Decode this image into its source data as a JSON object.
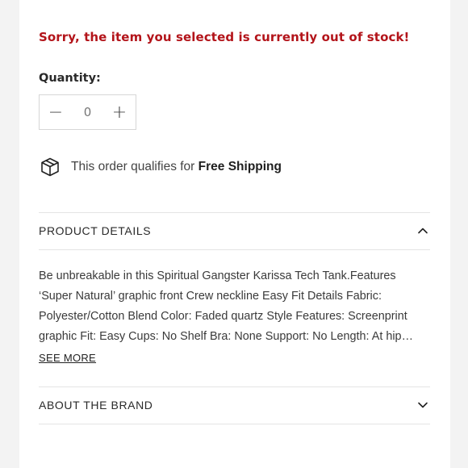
{
  "stock": {
    "message": "Sorry, the item you selected is currently out of stock!",
    "color": "#b3141a"
  },
  "quantity": {
    "label": "Quantity:",
    "value": "0",
    "decrement": "−",
    "increment": "+"
  },
  "shipping": {
    "icon": "package-box-icon",
    "prefix": "This order qualifies for ",
    "highlight": "Free Shipping"
  },
  "product_details": {
    "title": "PRODUCT DETAILS",
    "expanded": true,
    "chevron": "chevron-up-icon",
    "description": "Be unbreakable in this Spiritual Gangster Karissa Tech Tank.Features ‘Super Natural’ graphic front Crew neckline Easy Fit Details Fabric: Polyester/Cotton Blend Color: Faded quartz Style Features: Screenprint graphic Fit: Easy Cups: No Shelf Bra: None Support: No Length: At hip Care: Machine wash",
    "see_more": "SEE MORE"
  },
  "about_brand": {
    "title": "ABOUT THE BRAND",
    "expanded": false,
    "chevron": "chevron-down-icon"
  }
}
